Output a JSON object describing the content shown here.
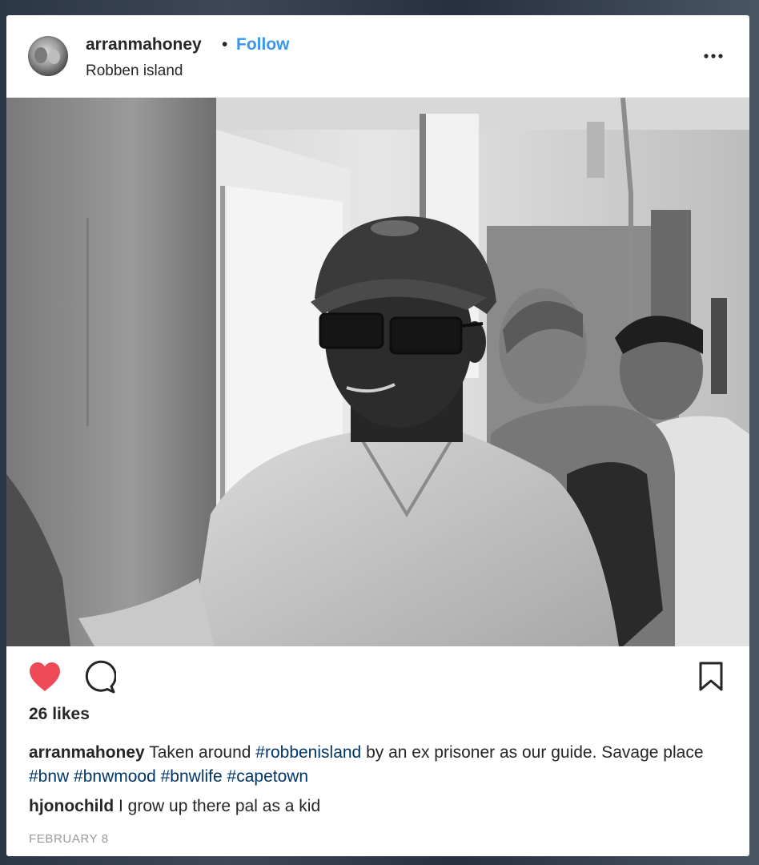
{
  "post": {
    "username": "arranmahoney",
    "separator": "•",
    "follow_label": "Follow",
    "location": "Robben island",
    "more_icon": "more-options-icon",
    "photo_alt": ""
  },
  "actions": {
    "like_icon": "heart-icon",
    "like_color": "#ed4956",
    "comment_icon": "comment-icon",
    "save_icon": "bookmark-icon"
  },
  "likes": "26 likes",
  "caption": {
    "username": "arranmahoney",
    "text1": " Taken around ",
    "tag1": "#robbenisland",
    "text2": " by an ex prisoner as our guide. Savage place ",
    "tag2": "#bnw",
    "sp1": " ",
    "tag3": "#bnwmood",
    "sp2": " ",
    "tag4": "#bnwlife",
    "sp3": " ",
    "tag5": "#capetown"
  },
  "comments": [
    {
      "username": "hjonochild",
      "text": " I grow up there pal as a kid"
    }
  ],
  "date": "FEBRUARY 8",
  "colors": {
    "link": "#3897f0",
    "hashtag": "#003569",
    "text": "#262626",
    "muted": "#999999"
  }
}
